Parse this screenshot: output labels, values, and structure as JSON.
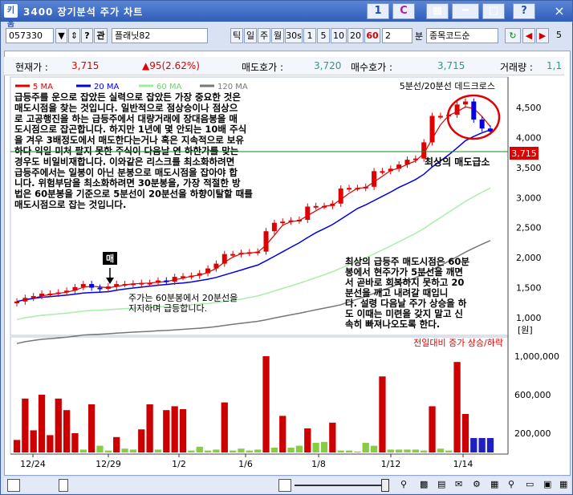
{
  "window": {
    "title": "3400 장기분석 주가 차트",
    "app_icon": "키움",
    "buttons": [
      "1",
      "C"
    ],
    "close_label": "×"
  },
  "toolbar": {
    "code": "057330",
    "badge": "관",
    "name": "플래닛82",
    "periods": [
      "틱",
      "일",
      "주",
      "월",
      "30s",
      "1",
      "5",
      "10",
      "20",
      "60",
      "2"
    ],
    "active_period": "60",
    "unit_label": "분",
    "sort_label": "종목코드순",
    "right_value": "5"
  },
  "quote": {
    "current_label": "현재가 :",
    "current_value": "3,715",
    "change_value": "▲95(2.62%)",
    "ask_label": "매도호가 :",
    "ask_value": "3,720",
    "bid_label": "매수호가 :",
    "bid_value": "3,715",
    "volume_label": "거래량 :",
    "volume_value": "1,1"
  },
  "legend": {
    "ma5": "5 MA",
    "ma20": "20 MA",
    "ma60": "60 MA",
    "ma120": "120 MA",
    "cross": "5분선/20분선 데드크로스"
  },
  "annotations": {
    "main_text": [
      "급등주를 운으로 잡았든 실력으로 잡았든 가장 중요한 것은",
      "매도시점을 찾는 것입니다. 일반적으로 점상승이나 점상으",
      "로 고공행진을 하는 급등주에서 대량거래에 장대음봉을 매",
      "도시점으로 잡곤합니다. 하지만 1년에 몇 안되는 10배 주식",
      "을 겨우 3배정도에서 매도한다는거나 혹은 지속적으로 보유",
      "하다 익일 미처 팔지 못한 주식이 다음날 연 하한가를 맞는",
      "경우도 비일비재합니다. 이와같은 리스크를 최소화하려면",
      "급등주에서는 일봉이 아닌 분봉으로 매도시점을 잡아야 합",
      "니다. 위험부담을 최소화하려면 30분봉을, 가장 적절한 방",
      "법은 60분봉을 기준으로 5분선이 20분선을 하향이탈할 때를",
      "매도시점으로 잡는 것입니다."
    ],
    "buy_label": "매",
    "support_text": [
      "주가는 60분봉에서 20분선을",
      "지지하며 급등합니다."
    ],
    "sell_label": "최상의 매도급소",
    "sell_text": [
      "최상의 급등주 매도시점은 60분",
      "봉에서 현주가가 5분선을 깨면",
      "서 곧바로 회복하지 못하고 20",
      "분선을 깨고 내려갈 때입니",
      "다. 설령 다음날 주가 상승을 하",
      "도 이때는 미련을 갖지 말고 신",
      "속히 빠져나오도록 한다."
    ]
  },
  "volume_legend": "전일대비 증가 상승/하락",
  "price_axis": {
    "labels": [
      "4,500",
      "4,000",
      "3,500",
      "3,000",
      "2,500",
      "2,000",
      "1,500",
      "1,000"
    ],
    "unit": "[원]",
    "current_tag": "3,715"
  },
  "volume_axis": {
    "labels": [
      "1,000,000",
      "600,000",
      "200,000"
    ]
  },
  "date_axis": {
    "labels": [
      "12/24",
      "12/29",
      "1/2",
      "1/6",
      "1/8",
      "1/12",
      "1/14"
    ]
  },
  "chart_data": {
    "type": "bar",
    "title": "",
    "xlabel": "",
    "ylabel": "[원]",
    "ylim": [
      1000,
      4700
    ],
    "candles_close": [
      1270,
      1330,
      1360,
      1400,
      1400,
      1420,
      1450,
      1510,
      1560,
      1500,
      1480,
      1520,
      1560,
      1560,
      1570,
      1580,
      1580,
      1620,
      1600,
      1680,
      1690,
      1700,
      1740,
      1820,
      1900,
      2060,
      2060,
      2080,
      2090,
      2100,
      2440,
      2580,
      2600,
      2620,
      2630,
      2850,
      2860,
      2860,
      2900,
      3150,
      3160,
      3160,
      3180,
      3440,
      3440,
      3480,
      3550,
      3630,
      3650,
      3920,
      4360,
      4360,
      4380,
      4550,
      4600,
      4300,
      4150,
      4100
    ],
    "volume": [
      130000,
      560000,
      230000,
      600000,
      180000,
      560000,
      440000,
      200000,
      30000,
      500000,
      70000,
      20000,
      160000,
      40000,
      30000,
      240000,
      500000,
      30000,
      440000,
      480000,
      450000,
      20000,
      60000,
      20000,
      30000,
      520000,
      20000,
      40000,
      20000,
      30000,
      1000000,
      50000,
      380000,
      50000,
      70000,
      250000,
      100000,
      110000,
      310000,
      20000,
      20000,
      10000,
      100000,
      70000,
      790000,
      30000,
      30000,
      30000,
      30000,
      20000,
      480000,
      40000,
      20000,
      940000,
      400000,
      150000,
      150000,
      150000
    ]
  }
}
